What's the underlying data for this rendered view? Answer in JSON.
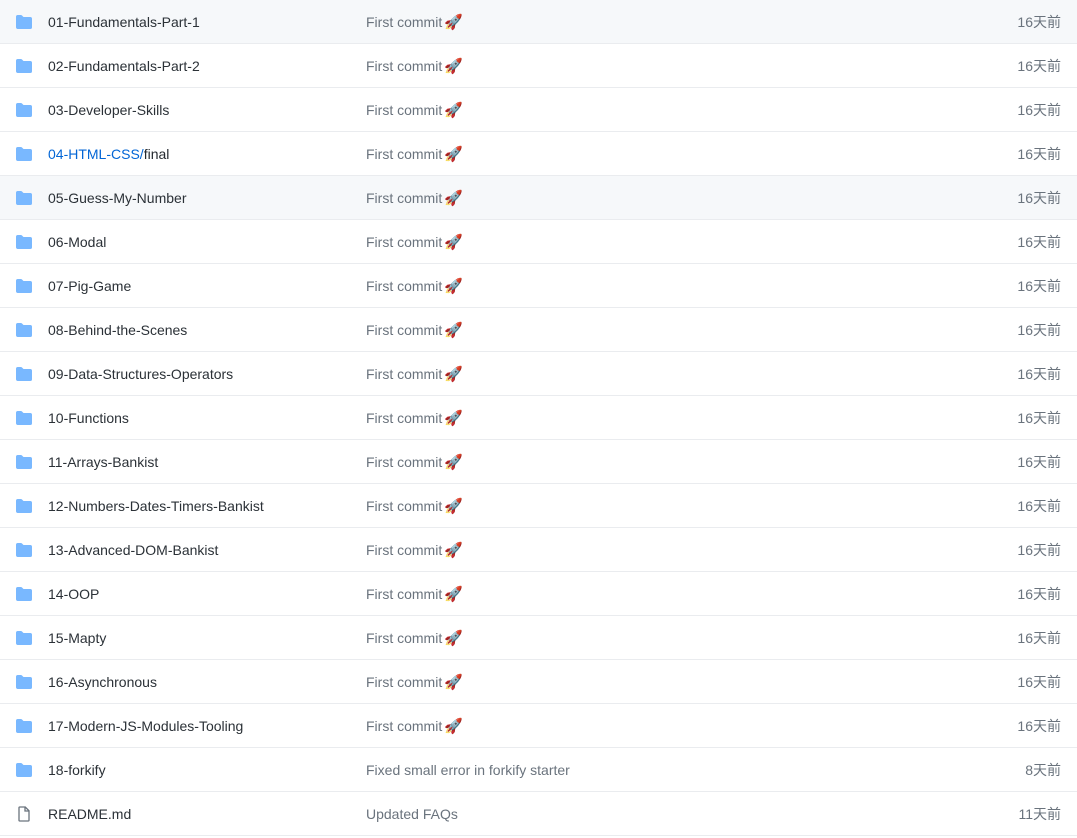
{
  "files": [
    {
      "type": "folder",
      "name": "01-Fundamentals-Part-1",
      "message": "First commit",
      "emoji": "🚀",
      "time": "16天前",
      "hovered": false
    },
    {
      "type": "folder",
      "name": "02-Fundamentals-Part-2",
      "message": "First commit",
      "emoji": "🚀",
      "time": "16天前",
      "hovered": false
    },
    {
      "type": "folder",
      "name": "03-Developer-Skills",
      "message": "First commit",
      "emoji": "🚀",
      "time": "16天前",
      "hovered": false
    },
    {
      "type": "folder",
      "name": "04-HTML-CSS/final",
      "message": "First commit",
      "emoji": "🚀",
      "time": "16天前",
      "hovered": false,
      "isPath": true
    },
    {
      "type": "folder",
      "name": "05-Guess-My-Number",
      "message": "First commit",
      "emoji": "🚀",
      "time": "16天前",
      "hovered": true
    },
    {
      "type": "folder",
      "name": "06-Modal",
      "message": "First commit",
      "emoji": "🚀",
      "time": "16天前",
      "hovered": false
    },
    {
      "type": "folder",
      "name": "07-Pig-Game",
      "message": "First commit",
      "emoji": "🚀",
      "time": "16天前",
      "hovered": false
    },
    {
      "type": "folder",
      "name": "08-Behind-the-Scenes",
      "message": "First commit",
      "emoji": "🚀",
      "time": "16天前",
      "hovered": false
    },
    {
      "type": "folder",
      "name": "09-Data-Structures-Operators",
      "message": "First commit",
      "emoji": "🚀",
      "time": "16天前",
      "hovered": false
    },
    {
      "type": "folder",
      "name": "10-Functions",
      "message": "First commit",
      "emoji": "🚀",
      "time": "16天前",
      "hovered": false
    },
    {
      "type": "folder",
      "name": "11-Arrays-Bankist",
      "message": "First commit",
      "emoji": "🚀",
      "time": "16天前",
      "hovered": false
    },
    {
      "type": "folder",
      "name": "12-Numbers-Dates-Timers-Bankist",
      "message": "First commit",
      "emoji": "🚀",
      "time": "16天前",
      "hovered": false
    },
    {
      "type": "folder",
      "name": "13-Advanced-DOM-Bankist",
      "message": "First commit",
      "emoji": "🚀",
      "time": "16天前",
      "hovered": false
    },
    {
      "type": "folder",
      "name": "14-OOP",
      "message": "First commit",
      "emoji": "🚀",
      "time": "16天前",
      "hovered": false
    },
    {
      "type": "folder",
      "name": "15-Mapty",
      "message": "First commit",
      "emoji": "🚀",
      "time": "16天前",
      "hovered": false
    },
    {
      "type": "folder",
      "name": "16-Asynchronous",
      "message": "First commit",
      "emoji": "🚀",
      "time": "16天前",
      "hovered": false
    },
    {
      "type": "folder",
      "name": "17-Modern-JS-Modules-Tooling",
      "message": "First commit",
      "emoji": "🚀",
      "time": "16天前",
      "hovered": false
    },
    {
      "type": "folder",
      "name": "18-forkify",
      "message": "Fixed small error in forkify starter",
      "emoji": "",
      "time": "8天前",
      "hovered": false
    },
    {
      "type": "file",
      "name": "README.md",
      "message": "Updated FAQs",
      "emoji": "",
      "time": "11天前",
      "hovered": false
    }
  ]
}
